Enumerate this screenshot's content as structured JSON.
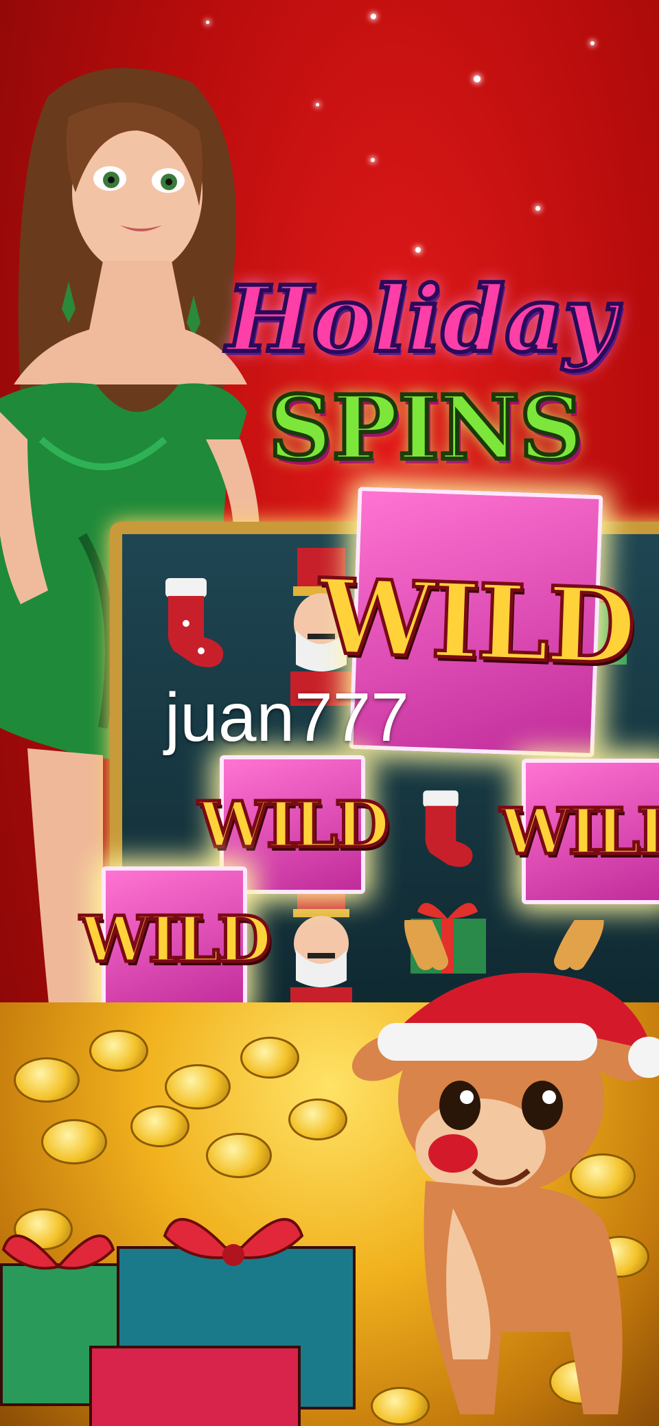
{
  "game": {
    "title_line1": "Holiday",
    "title_line2": "SPINS",
    "symbols": {
      "wild_label": "WILD"
    }
  },
  "overlay": {
    "watermark": "juan777"
  },
  "colors": {
    "background": "#c40e0e",
    "logo_pink": "#ff3fa8",
    "logo_green": "#7de63a",
    "wild_tile": "#e64fb6",
    "gold": "#f4c22a"
  },
  "icons": {
    "characters": [
      "woman-in-green-dress",
      "reindeer-with-santa-hat",
      "nutcracker"
    ],
    "decor": [
      "christmas-stocking",
      "gift-box",
      "gold-coin-pile"
    ]
  }
}
